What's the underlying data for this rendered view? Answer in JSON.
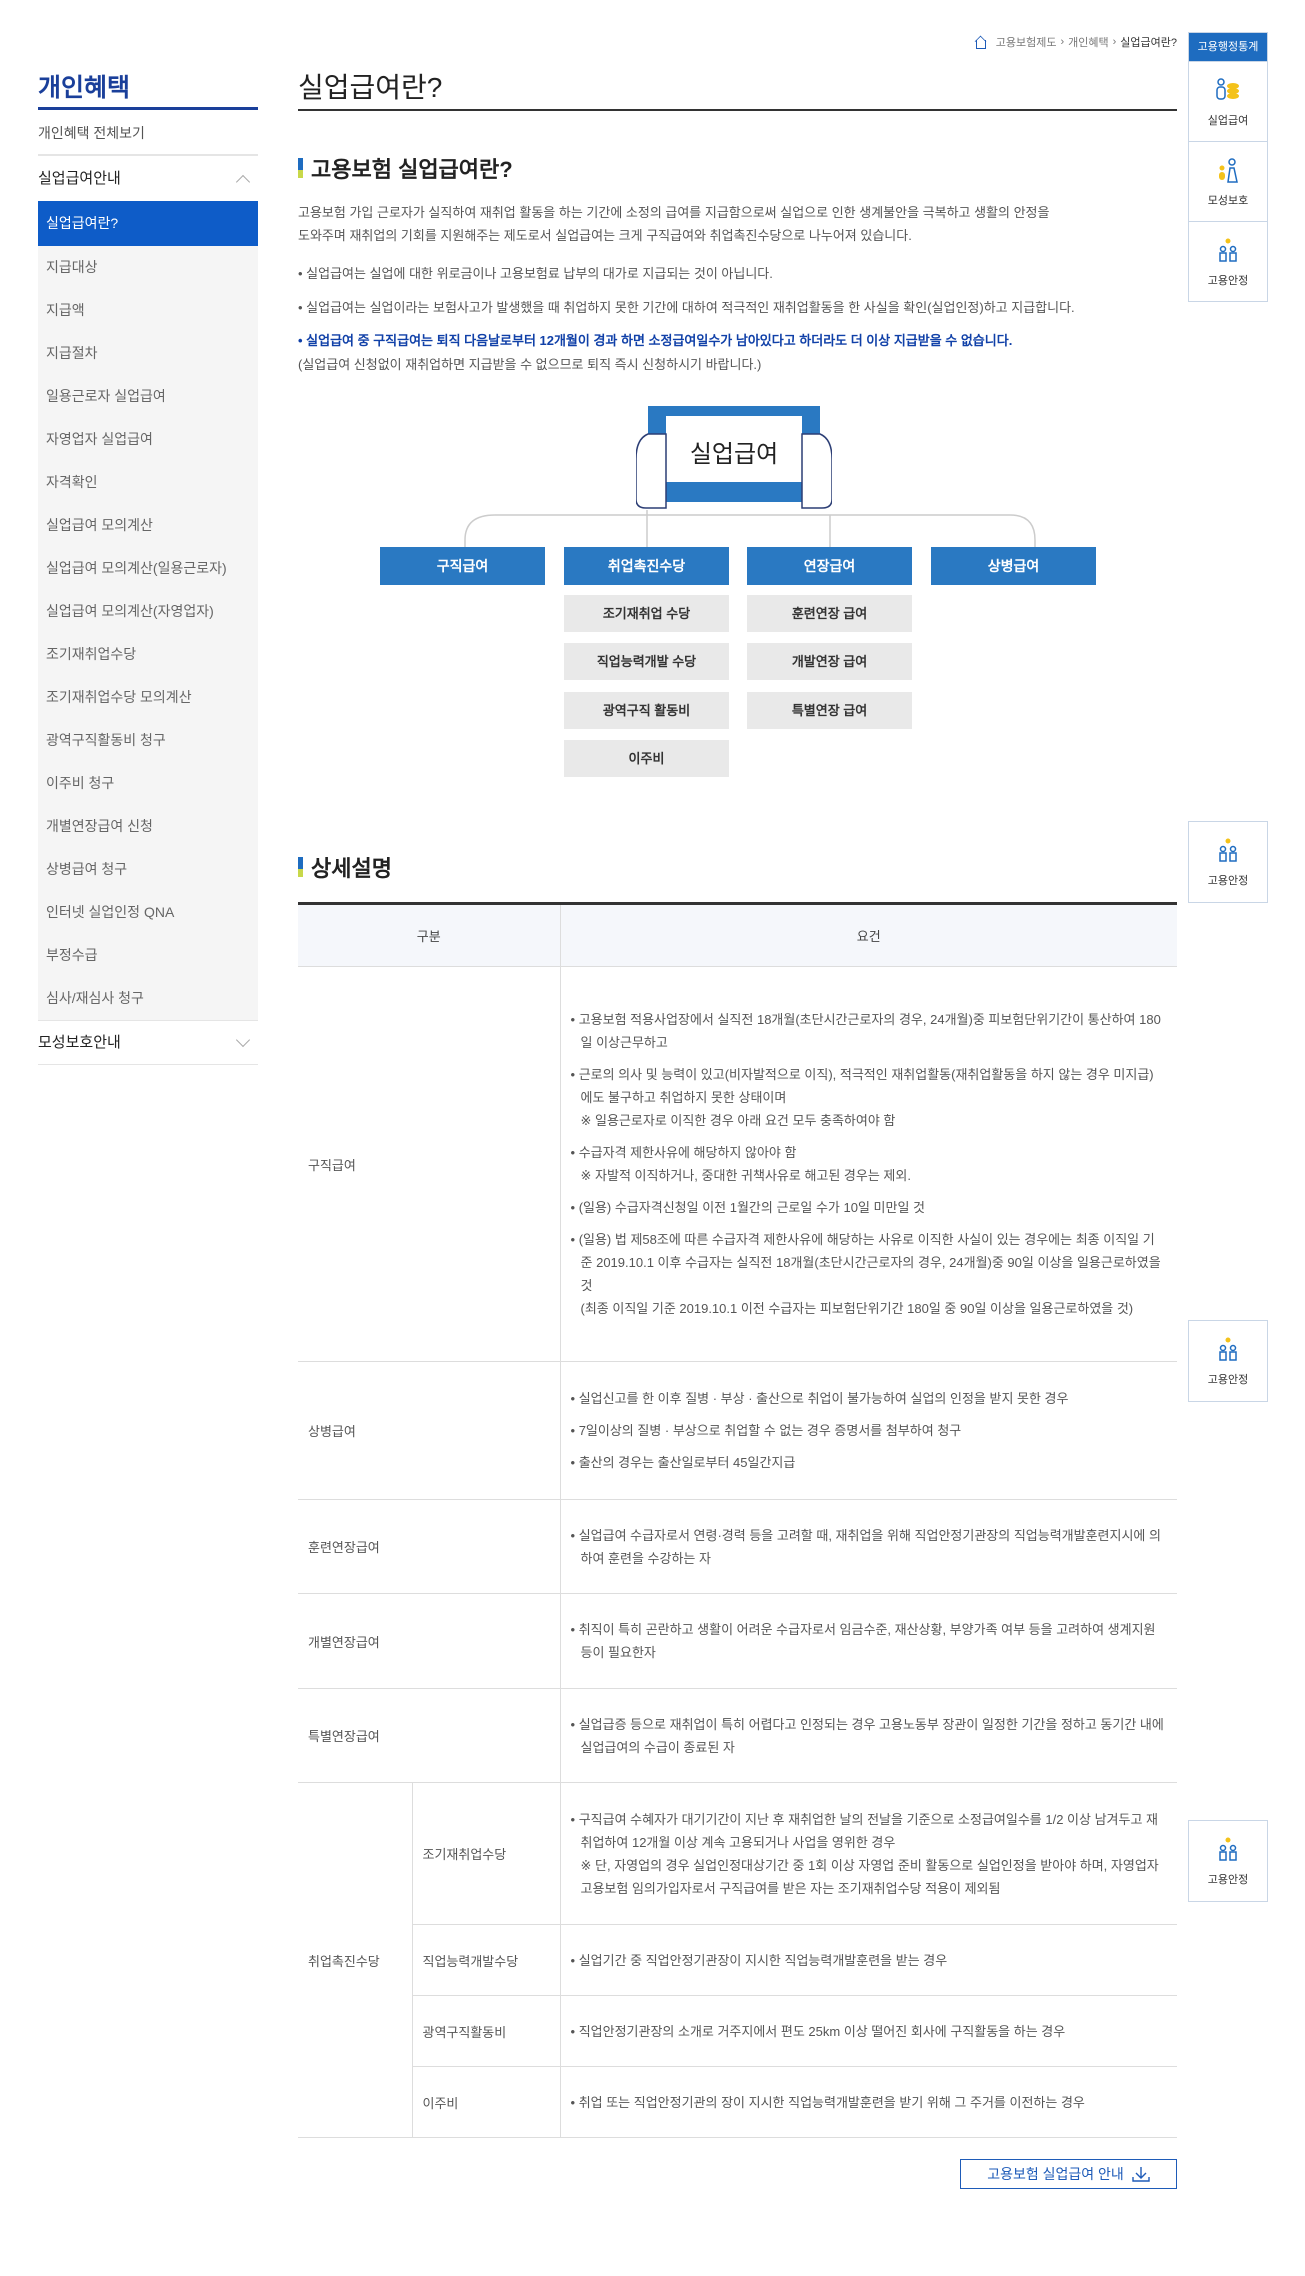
{
  "breadcrumb": {
    "items": [
      "고용보험제도",
      "개인혜택"
    ],
    "current": "실업급여란?"
  },
  "quickbar": {
    "title": "고용행정통계",
    "items": [
      "실업급여",
      "모성보호",
      "고용안정"
    ],
    "floating": [
      "고용안정",
      "고용안정",
      "고용안정"
    ]
  },
  "sidebar": {
    "title": "개인혜택",
    "all": "개인혜택 전체보기",
    "group": "실업급여안내",
    "items": [
      "실업급여란?",
      "지급대상",
      "지급액",
      "지급절차",
      "일용근로자 실업급여",
      "자영업자 실업급여",
      "자격확인",
      "실업급여 모의계산",
      "실업급여 모의계산(일용근로자)",
      "실업급여 모의계산(자영업자)",
      "조기재취업수당",
      "조기재취업수당 모의계산",
      "광역구직활동비 청구",
      "이주비 청구",
      "개별연장급여 신청",
      "상병급여 청구",
      "인터넷 실업인정 QNA",
      "부정수급",
      "심사/재심사 청구"
    ],
    "group2": "모성보호안내"
  },
  "page_title": "실업급여란?",
  "intro": {
    "heading": "고용보험 실업급여란?",
    "para1": "고용보험 가입 근로자가 실직하여 재취업 활동을 하는 기간에 소정의 급여를 지급함으로써 실업으로 인한 생계불안을 극복하고 생활의 안정을",
    "para2": "도와주며 재취업의 기회를 지원해주는 제도로서 실업급여는 크게 구직급여와 취업촉진수당으로 나누어져 있습니다.",
    "bullets": [
      "실업급여는 실업에 대한 위로금이나 고용보험료 납부의 대가로 지급되는 것이 아닙니다.",
      "실업급여는 실업이라는 보험사고가 발생했을 때 취업하지 못한 기간에 대하여 적극적인 재취업활동을 한 사실을 확인(실업인정)하고 지급합니다."
    ],
    "notice1": "실업급여 중 구직급여는 퇴직 다음날로부터 12개월이 경과 하면 소정급여일수가 남아있다고 하더라도 더 이상 지급받을 수 없습니다.",
    "notice2": "(실업급여 신청없이 재취업하면 지급받을 수 없으므로 퇴직 즉시 신청하시기 바랍니다.)"
  },
  "diagram": {
    "center": "실업급여",
    "categories": [
      "구직급여",
      "취업촉진수당",
      "연장급여",
      "상병급여"
    ],
    "promotion": [
      "조기재취업 수당",
      "직업능력개발 수당",
      "광역구직 활동비",
      "이주비"
    ],
    "extension": [
      "훈련연장 급여",
      "개발연장 급여",
      "특별연장 급여"
    ]
  },
  "detail": {
    "heading": "상세설명",
    "headers": [
      "구분",
      "요건"
    ],
    "rows": [
      {
        "label": "구직급여",
        "items": [
          [
            "고용보험 적용사업장에서 실직전 18개월(초단시간근로자의 경우, 24개월)중 피보험단위기간이 통산하여 180일 이상근무하고"
          ],
          [
            "근로의 의사 및 능력이 있고(비자발적으로 이직), 적극적인 재취업활동(재취업활동을 하지 않는 경우 미지급)에도 불구하고 취업하지 못한 상태이며",
            "※ 일용근로자로 이직한 경우 아래 요건 모두 충족하여야 함"
          ],
          [
            "수급자격 제한사유에 해당하지 않아야 함",
            "※ 자발적 이직하거나, 중대한 귀책사유로 해고된 경우는 제외."
          ],
          [
            "(일용) 수급자격신청일 이전 1월간의 근로일 수가 10일 미만일 것"
          ],
          [
            "(일용) 법 제58조에 따른 수급자격 제한사유에 해당하는 사유로 이직한 사실이 있는 경우에는 최종 이직일 기준 2019.10.1 이후 수급자는 실직전 18개월(초단시간근로자의 경우, 24개월)중 90일 이상을 일용근로하였을 것",
            "(최종 이직일 기준 2019.10.1 이전 수급자는 피보험단위기간 180일 중 90일 이상을 일용근로하였을 것)"
          ]
        ]
      },
      {
        "label": "상병급여",
        "items": [
          [
            "실업신고를 한 이후 질병 · 부상 · 출산으로 취업이 불가능하여 실업의 인정을 받지 못한 경우"
          ],
          [
            "7일이상의 질병 · 부상으로 취업할 수 없는 경우 증명서를 첨부하여 청구"
          ],
          [
            "출산의 경우는 출산일로부터 45일간지급"
          ]
        ]
      },
      {
        "label": "훈련연장급여",
        "items": [
          [
            "실업급여 수급자로서 연령·경력 등을 고려할 때, 재취업을 위해 직업안정기관장의 직업능력개발훈련지시에 의하여 훈련을 수강하는 자"
          ]
        ]
      },
      {
        "label": "개별연장급여",
        "items": [
          [
            "취직이 특히 곤란하고 생활이 어려운 수급자로서 임금수준, 재산상황, 부양가족 여부 등을 고려하여 생계지원 등이 필요한자"
          ]
        ]
      },
      {
        "label": "특별연장급여",
        "items": [
          [
            "실업급증 등으로 재취업이 특히 어렵다고 인정되는 경우 고용노동부 장관이 일정한 기간을 정하고 동기간 내에 실업급여의 수급이 종료된 자"
          ]
        ]
      }
    ],
    "promotion": {
      "label": "취업촉진수당",
      "rows": [
        {
          "label": "조기재취업수당",
          "items": [
            [
              "구직급여 수혜자가 대기기간이 지난 후 재취업한 날의 전날을 기준으로 소정급여일수를 1/2 이상 남겨두고 재취업하여 12개월 이상 계속 고용되거나 사업을 영위한 경우",
              "※ 단, 자영업의 경우 실업인정대상기간 중 1회 이상 자영업 준비 활동으로 실업인정을 받아야 하며, 자영업자 고용보험 임의가입자로서 구직급여를 받은 자는 조기재취업수당 적용이 제외됨"
            ]
          ]
        },
        {
          "label": "직업능력개발수당",
          "items": [
            [
              "실업기간 중 직업안정기관장이 지시한 직업능력개발훈련을 받는 경우"
            ]
          ]
        },
        {
          "label": "광역구직활동비",
          "items": [
            [
              "직업안정기관장의 소개로 거주지에서 편도 25km 이상 떨어진 회사에 구직활동을 하는 경우"
            ]
          ]
        },
        {
          "label": "이주비",
          "items": [
            [
              "취업 또는 직업안정기관의 장이 지시한 직업능력개발훈련을 받기 위해 그 주거를 이전하는 경우"
            ]
          ]
        }
      ]
    }
  },
  "download_button": "고용보험 실업급여 안내",
  "colors": {
    "primary": "#1e6cc0",
    "active": "#0e5cc8",
    "navy": "#1a3f9a",
    "notice": "#1040a8"
  }
}
